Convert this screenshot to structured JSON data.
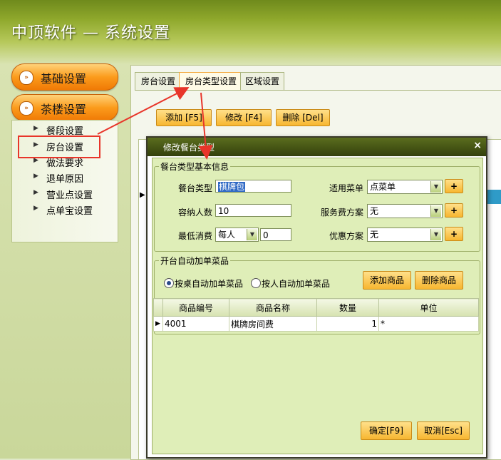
{
  "app": {
    "title": "中顶软件 — 系统设置"
  },
  "nav": {
    "sections": [
      {
        "label": "基础设置"
      },
      {
        "label": "茶楼设置"
      }
    ],
    "items": [
      {
        "label": "餐段设置"
      },
      {
        "label": "房台设置"
      },
      {
        "label": "做法要求"
      },
      {
        "label": "退单原因"
      },
      {
        "label": "营业点设置"
      },
      {
        "label": "点单宝设置"
      }
    ]
  },
  "tabs": [
    "房台设置",
    "房台类型设置",
    "区域设置"
  ],
  "toolbar": {
    "add": "添加 [F5]",
    "edit": "修改 [F4]",
    "delete": "删除 [Del]"
  },
  "dialog": {
    "title": "修改餐台类型",
    "basic_group": "餐台类型基本信息",
    "fields": {
      "type_label": "餐台类型",
      "type_value": "棋牌包",
      "capacity_label": "容纳人数",
      "capacity_value": "10",
      "min_label": "最低消费",
      "min_mode": "每人",
      "min_value": "0",
      "menu_label": "适用菜单",
      "menu_value": "点菜单",
      "service_label": "服务费方案",
      "service_value": "无",
      "discount_label": "优惠方案",
      "discount_value": "无"
    },
    "auto_group": "开台自动加单菜品",
    "radio_by_table": "按桌自动加单菜品",
    "radio_by_person": "按人自动加单菜品",
    "add_item": "添加商品",
    "delete_item": "删除商品",
    "table": {
      "columns": [
        "商品编号",
        "商品名称",
        "数量",
        "单位"
      ],
      "rows": [
        {
          "code": "4001",
          "name": "棋牌房间费",
          "qty": "1",
          "unit": "*"
        }
      ]
    },
    "ok": "确定[F9]",
    "cancel": "取消[Esc]"
  },
  "colors": {
    "accent": "#f7a21b",
    "annotation": "#e8352a",
    "title_bar": "#3f4d14"
  }
}
